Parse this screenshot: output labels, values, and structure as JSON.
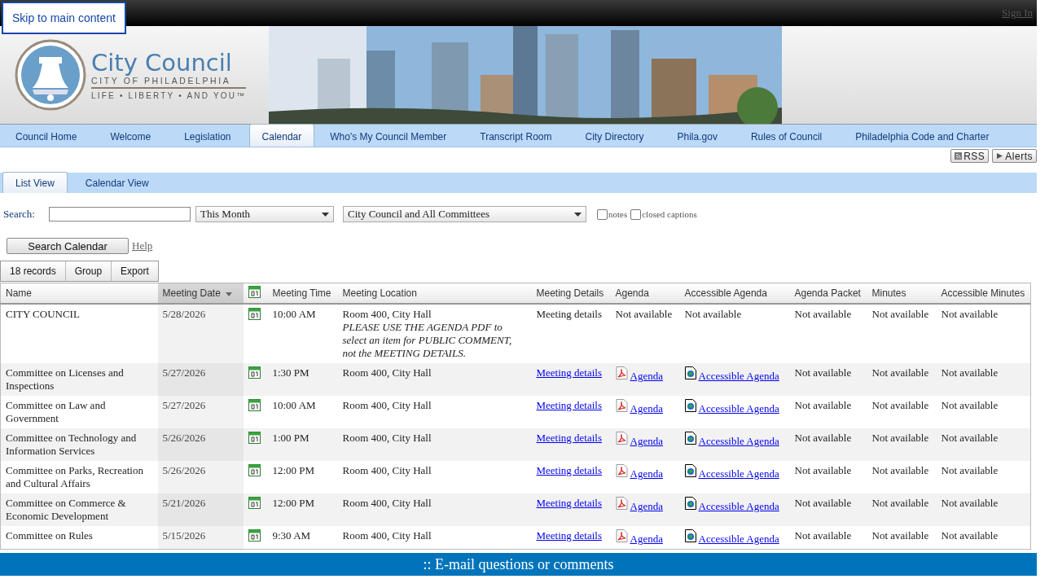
{
  "skip_link": "Skip to main content",
  "sign_in": "Sign In",
  "logo": {
    "title": "City Council",
    "subtitle": "CITY OF PHILADELPHIA",
    "tagline": "LIFE • LIBERTY • AND YOU™"
  },
  "nav_tabs": [
    {
      "label": "Council Home",
      "selected": false
    },
    {
      "label": "Welcome",
      "selected": false
    },
    {
      "label": "Legislation",
      "selected": false
    },
    {
      "label": "Calendar",
      "selected": true
    },
    {
      "label": "Who's My Council Member",
      "selected": false
    },
    {
      "label": "Transcript Room",
      "selected": false
    },
    {
      "label": "City Directory",
      "selected": false
    },
    {
      "label": "Phila.gov",
      "selected": false
    },
    {
      "label": "Rules of Council",
      "selected": false
    },
    {
      "label": "Philadelphia Code and Charter",
      "selected": false
    }
  ],
  "feed_buttons": [
    {
      "kind": "rss",
      "label": "RSS"
    },
    {
      "kind": "alerts",
      "label": "Alerts"
    }
  ],
  "view_tabs": [
    {
      "label": "List View",
      "selected": true
    },
    {
      "label": "Calendar View",
      "selected": false
    }
  ],
  "search": {
    "label": "Search:",
    "dropdowns": [
      "This Month",
      "City Council and All Committees"
    ],
    "checkboxes": [
      {
        "label": "notes",
        "checked": false
      },
      {
        "label": "closed captions",
        "checked": false
      }
    ],
    "button": "Search Calendar",
    "help": "Help"
  },
  "toolbar": [
    "18 records",
    "Group",
    "Export"
  ],
  "table": {
    "columns": [
      {
        "kind": "text",
        "label": "Name",
        "sorted": false
      },
      {
        "kind": "text",
        "label": "Meeting Date",
        "sorted": true
      },
      {
        "kind": "icon",
        "sorted": false
      },
      {
        "kind": "text",
        "label": "Meeting Time",
        "sorted": false
      },
      {
        "kind": "text",
        "label": "Meeting Location",
        "sorted": false
      },
      {
        "kind": "text",
        "label": "Meeting Details",
        "sorted": false
      },
      {
        "kind": "text",
        "label": "Agenda",
        "sorted": false
      },
      {
        "kind": "text",
        "label": "Accessible Agenda",
        "sorted": false
      },
      {
        "kind": "text",
        "label": "Agenda Packet",
        "sorted": false
      },
      {
        "kind": "text",
        "label": "Minutes",
        "sorted": false
      },
      {
        "kind": "text",
        "label": "Accessible Minutes",
        "sorted": false
      }
    ],
    "rows": [
      {
        "name": "CITY COUNCIL",
        "date": "5/28/2026",
        "time": "10:00 AM",
        "location": "Room 400, City Hall",
        "note": "PLEASE USE THE AGENDA PDF to select an item for PUBLIC COMMENT, not the MEETING DETAILS.",
        "details": {
          "kind": "text",
          "text": "Meeting details"
        },
        "agenda": {
          "kind": "text",
          "text": "Not available"
        },
        "accessible_agenda": {
          "kind": "text",
          "text": "Not available"
        },
        "packet": "Not available",
        "minutes": "Not available",
        "accessible_minutes": "Not available"
      },
      {
        "name": "Committee on Licenses and Inspections",
        "date": "5/27/2026",
        "time": "1:30 PM",
        "location": "Room 400, City Hall",
        "details": {
          "kind": "link",
          "text": "Meeting details"
        },
        "agenda": {
          "kind": "link",
          "text": "Agenda"
        },
        "accessible_agenda": {
          "kind": "link",
          "text": "Accessible Agenda"
        },
        "packet": "Not available",
        "minutes": "Not available",
        "accessible_minutes": "Not available"
      },
      {
        "name": "Committee on Law and Government",
        "date": "5/27/2026",
        "time": "10:00 AM",
        "location": "Room 400, City Hall",
        "details": {
          "kind": "link",
          "text": "Meeting details"
        },
        "agenda": {
          "kind": "link",
          "text": "Agenda"
        },
        "accessible_agenda": {
          "kind": "link",
          "text": "Accessible Agenda"
        },
        "packet": "Not available",
        "minutes": "Not available",
        "accessible_minutes": "Not available"
      },
      {
        "name": "Committee on Technology and Information Services",
        "date": "5/26/2026",
        "time": "1:00 PM",
        "location": "Room 400, City Hall",
        "details": {
          "kind": "link",
          "text": "Meeting details"
        },
        "agenda": {
          "kind": "link",
          "text": "Agenda"
        },
        "accessible_agenda": {
          "kind": "link",
          "text": "Accessible Agenda"
        },
        "packet": "Not available",
        "minutes": "Not available",
        "accessible_minutes": "Not available"
      },
      {
        "name": "Committee on Parks, Recreation and Cultural Affairs",
        "date": "5/26/2026",
        "time": "12:00 PM",
        "location": "Room 400, City Hall",
        "details": {
          "kind": "link",
          "text": "Meeting details"
        },
        "agenda": {
          "kind": "link",
          "text": "Agenda"
        },
        "accessible_agenda": {
          "kind": "link",
          "text": "Accessible Agenda"
        },
        "packet": "Not available",
        "minutes": "Not available",
        "accessible_minutes": "Not available"
      },
      {
        "name": "Committee on Commerce & Economic Development",
        "date": "5/21/2026",
        "time": "12:00 PM",
        "location": "Room 400, City Hall",
        "details": {
          "kind": "link",
          "text": "Meeting details"
        },
        "agenda": {
          "kind": "link",
          "text": "Agenda"
        },
        "accessible_agenda": {
          "kind": "link",
          "text": "Accessible Agenda"
        },
        "packet": "Not available",
        "minutes": "Not available",
        "accessible_minutes": "Not available"
      },
      {
        "name": "Committee on Rules",
        "date": "5/15/2026",
        "time": "9:30 AM",
        "location": "Room 400, City Hall",
        "details": {
          "kind": "link",
          "text": "Meeting details"
        },
        "agenda": {
          "kind": "link",
          "text": "Agenda"
        },
        "accessible_agenda": {
          "kind": "link",
          "text": "Accessible Agenda"
        },
        "packet": "Not available",
        "minutes": "Not available",
        "accessible_minutes": "Not available"
      }
    ]
  },
  "footer": ":: E-mail questions or comments"
}
